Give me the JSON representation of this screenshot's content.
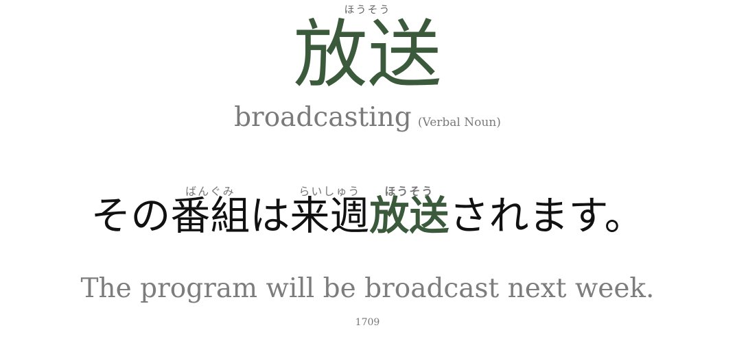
{
  "word": {
    "reading": "ほうそう",
    "kanji": "放送",
    "meaning": "broadcasting",
    "part_of_speech": "(Verbal Noun)"
  },
  "sentence": {
    "segments": [
      {
        "text": "その",
        "reading": ""
      },
      {
        "text": "番組",
        "reading": "ばんぐみ"
      },
      {
        "text": "は",
        "reading": ""
      },
      {
        "text": "来週",
        "reading": "らいしゅう"
      },
      {
        "text": "放送",
        "reading": "ほうそう"
      },
      {
        "text": "されます。",
        "reading": ""
      }
    ],
    "translation": "The program will be broadcast next week."
  },
  "card_number": "1709",
  "colors": {
    "accent": "#3b5a3b",
    "muted": "#7a7a7a"
  }
}
